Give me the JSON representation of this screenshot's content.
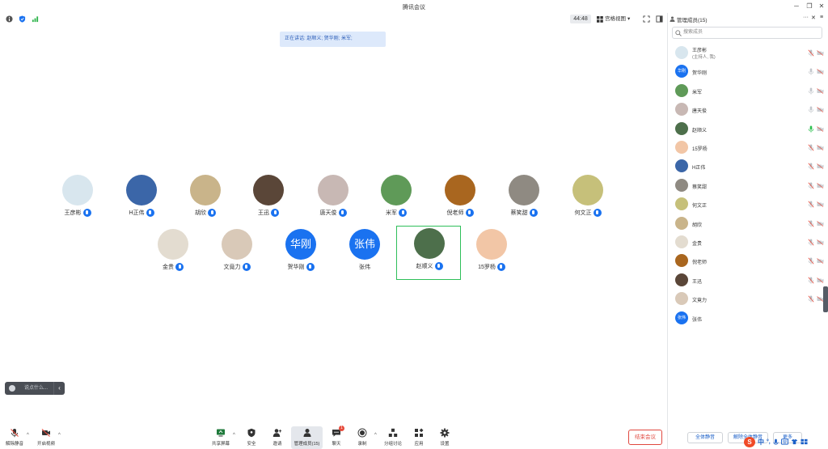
{
  "window": {
    "title": "腾讯会议"
  },
  "topbar": {
    "timer": "44:48",
    "view_label": "宫格视图"
  },
  "speaking": "正在讲话: 赵顺义; 贺华刚; 米军;",
  "grid": [
    {
      "name": "王彦彬",
      "bg": "#d8e6ee"
    },
    {
      "name": "H正伟",
      "bg": "#3b66a8"
    },
    {
      "name": "胡欣",
      "bg": "#c9b48a"
    },
    {
      "name": "王迅",
      "bg": "#5a4638"
    },
    {
      "name": "唐天俊",
      "bg": "#c8b8b4"
    },
    {
      "name": "米军",
      "bg": "#5f9a58"
    },
    {
      "name": "倪老师",
      "bg": "#a9661f"
    },
    {
      "name": "蔡笑甜",
      "bg": "#8f8a82"
    },
    {
      "name": "何文正",
      "bg": "#c6c07a"
    },
    {
      "name": "金贵",
      "bg": "#e3dcd0"
    },
    {
      "name": "文竟力",
      "bg": "#d9c9b8"
    },
    {
      "name": "贺华刚",
      "text": "华刚"
    },
    {
      "name": "张伟",
      "text": "张伟"
    },
    {
      "name": "赵顺义",
      "bg": "#4d6f4b"
    },
    {
      "name": "15罗杨",
      "bg": "#f2c6a6"
    }
  ],
  "chat": {
    "placeholder": "说点什么..."
  },
  "toolbar": {
    "mute": "解除静音",
    "video": "开启视频",
    "share": "共享屏幕",
    "security": "安全",
    "invite": "邀请",
    "manage": "管理成员(15)",
    "chat": "聊天",
    "chat_badge": "1",
    "record": "录制",
    "breakout": "分组讨论",
    "apps": "应用",
    "settings": "设置",
    "end": "结束会议"
  },
  "panel": {
    "title": "管理成员(15)",
    "search_placeholder": "搜索成员",
    "members": [
      {
        "name": "王彦彬",
        "sub": "(主持人, 我)",
        "bg": "#d8e6ee",
        "mic": "muted",
        "cam": "off"
      },
      {
        "name": "贺华刚",
        "text": "华刚",
        "mic": "idle",
        "cam": "off"
      },
      {
        "name": "米军",
        "bg": "#5f9a58",
        "mic": "idle",
        "cam": "off"
      },
      {
        "name": "唐天俊",
        "bg": "#c8b8b4",
        "mic": "idle",
        "cam": "off"
      },
      {
        "name": "赵顺义",
        "bg": "#4d6f4b",
        "mic": "speaking",
        "cam": "off"
      },
      {
        "name": "15罗杨",
        "bg": "#f2c6a6",
        "mic": "muted",
        "cam": "off"
      },
      {
        "name": "H正伟",
        "bg": "#3b66a8",
        "mic": "muted",
        "cam": "off"
      },
      {
        "name": "蔡笑甜",
        "bg": "#8f8a82",
        "mic": "muted",
        "cam": "off"
      },
      {
        "name": "何文正",
        "bg": "#c6c07a",
        "mic": "muted",
        "cam": "off"
      },
      {
        "name": "胡欣",
        "bg": "#c9b48a",
        "mic": "muted",
        "cam": "off"
      },
      {
        "name": "金贵",
        "bg": "#e3dcd0",
        "mic": "muted",
        "cam": "off"
      },
      {
        "name": "倪老师",
        "bg": "#a9661f",
        "mic": "muted",
        "cam": "off"
      },
      {
        "name": "王迅",
        "bg": "#5a4638",
        "mic": "muted",
        "cam": "off"
      },
      {
        "name": "文竟力",
        "bg": "#d9c9b8",
        "mic": "muted",
        "cam": "off"
      },
      {
        "name": "张伟",
        "text": "张伟",
        "mic": "none",
        "cam": "none"
      }
    ],
    "mute_all": "全体静音",
    "unmute_all": "解除全体静音",
    "more": "更多"
  },
  "ime": {
    "logo": "S",
    "mode": "中"
  }
}
